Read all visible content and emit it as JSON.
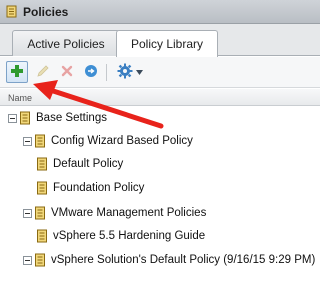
{
  "window": {
    "title": "Policies"
  },
  "tabs": [
    {
      "label": "Active Policies"
    },
    {
      "label": "Policy Library"
    }
  ],
  "toolbar": {
    "add_icon": "add-plus-icon",
    "edit_icon": "pencil-icon",
    "delete_icon": "delete-x-icon",
    "refresh_icon": "refresh-arrow-icon",
    "actions_icon": "gear-icon"
  },
  "list": {
    "column_header": "Name"
  },
  "tree": {
    "items": [
      {
        "label": "Base Settings"
      },
      {
        "label": "Config Wizard Based Policy"
      },
      {
        "label": "Default Policy"
      },
      {
        "label": "Foundation Policy"
      },
      {
        "label": "VMware Management Policies"
      },
      {
        "label": "vSphere 5.5 Hardening Guide"
      },
      {
        "label": "vSphere Solution's Default Policy (9/16/15 9:29 PM)"
      }
    ]
  },
  "colors": {
    "annotation_arrow": "#e8231b",
    "add_green": "#2e9a2e"
  }
}
